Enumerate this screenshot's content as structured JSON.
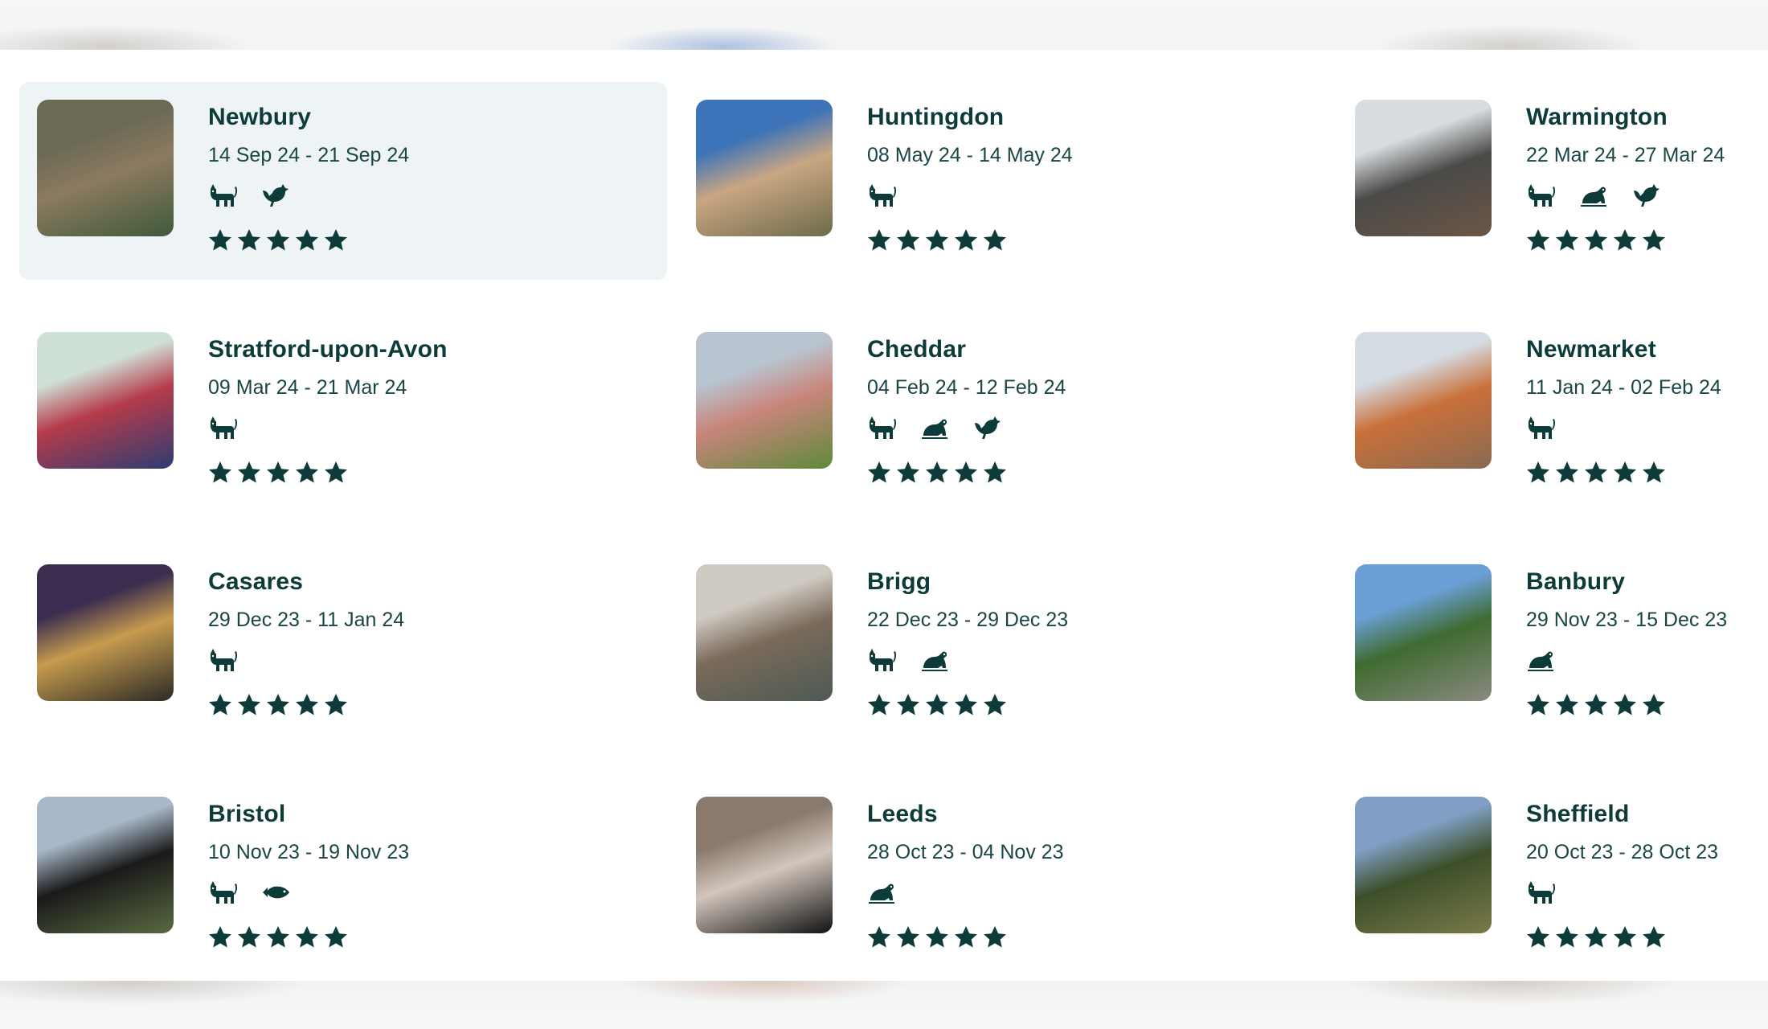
{
  "theme": {
    "text": "#0d3b3a",
    "active_card_bg": "#eef3f5",
    "star_color": "#0d3b3a"
  },
  "sits": [
    {
      "city": "Newbury",
      "dates": "14 Sep 24 - 21 Sep 24",
      "pets": [
        "cat-icon",
        "bird-icon"
      ],
      "rating": 5,
      "active": true,
      "photo": [
        "#6b6a55",
        "#8c7a60",
        "#3f5a3a"
      ]
    },
    {
      "city": "Huntingdon",
      "dates": "08 May 24 - 14 May 24",
      "pets": [
        "cat-icon"
      ],
      "rating": 5,
      "photo": [
        "#3d73b8",
        "#c9a682",
        "#6d6a4a"
      ]
    },
    {
      "city": "Warmington",
      "dates": "22 Mar 24 - 27 Mar 24",
      "pets": [
        "cat-icon",
        "rodent-icon",
        "bird-icon"
      ],
      "rating": 5,
      "photo": [
        "#d9dde0",
        "#4a4a48",
        "#6b5646"
      ]
    },
    {
      "city": "Stratford-upon-Avon",
      "dates": "09 Mar 24 - 21 Mar 24",
      "pets": [
        "cat-icon"
      ],
      "rating": 5,
      "photo": [
        "#cfe0d6",
        "#b53b4a",
        "#2d3c73"
      ]
    },
    {
      "city": "Cheddar",
      "dates": "04 Feb 24 - 12 Feb 24",
      "pets": [
        "cat-icon",
        "rodent-icon",
        "bird-icon"
      ],
      "rating": 5,
      "photo": [
        "#b8c4cf",
        "#c9857c",
        "#5e8a3a"
      ]
    },
    {
      "city": "Newmarket",
      "dates": "11 Jan 24 - 02 Feb 24",
      "pets": [
        "cat-icon"
      ],
      "rating": 5,
      "photo": [
        "#d5dce3",
        "#c9703a",
        "#8a6a52"
      ]
    },
    {
      "city": "Casares",
      "dates": "29 Dec 23 - 11 Jan 24",
      "pets": [
        "cat-icon"
      ],
      "rating": 5,
      "photo": [
        "#3b2d4f",
        "#c69b4e",
        "#2a2a24"
      ]
    },
    {
      "city": "Brigg",
      "dates": "22 Dec 23 - 29 Dec 23",
      "pets": [
        "cat-icon",
        "rodent-icon"
      ],
      "rating": 5,
      "photo": [
        "#cfcac2",
        "#7a6a5a",
        "#4d5a54"
      ]
    },
    {
      "city": "Banbury",
      "dates": "29 Nov 23 - 15 Dec 23",
      "pets": [
        "rodent-icon"
      ],
      "rating": 5,
      "photo": [
        "#6aa0d6",
        "#3f6b30",
        "#8a8a80"
      ]
    },
    {
      "city": "Bristol",
      "dates": "10 Nov 23 - 19 Nov 23",
      "pets": [
        "cat-icon",
        "fish-icon"
      ],
      "rating": 5,
      "photo": [
        "#a8b8c8",
        "#1a1a1a",
        "#5a6a40"
      ]
    },
    {
      "city": "Leeds",
      "dates": "28 Oct 23 - 04 Nov 23",
      "pets": [
        "rodent-icon"
      ],
      "rating": 5,
      "photo": [
        "#8a7a6e",
        "#d2c6bc",
        "#111111"
      ]
    },
    {
      "city": "Sheffield",
      "dates": "20 Oct 23 - 28 Oct 23",
      "pets": [
        "cat-icon"
      ],
      "rating": 5,
      "photo": [
        "#7f9fc4",
        "#3d4f2a",
        "#7a7a4a"
      ]
    }
  ]
}
